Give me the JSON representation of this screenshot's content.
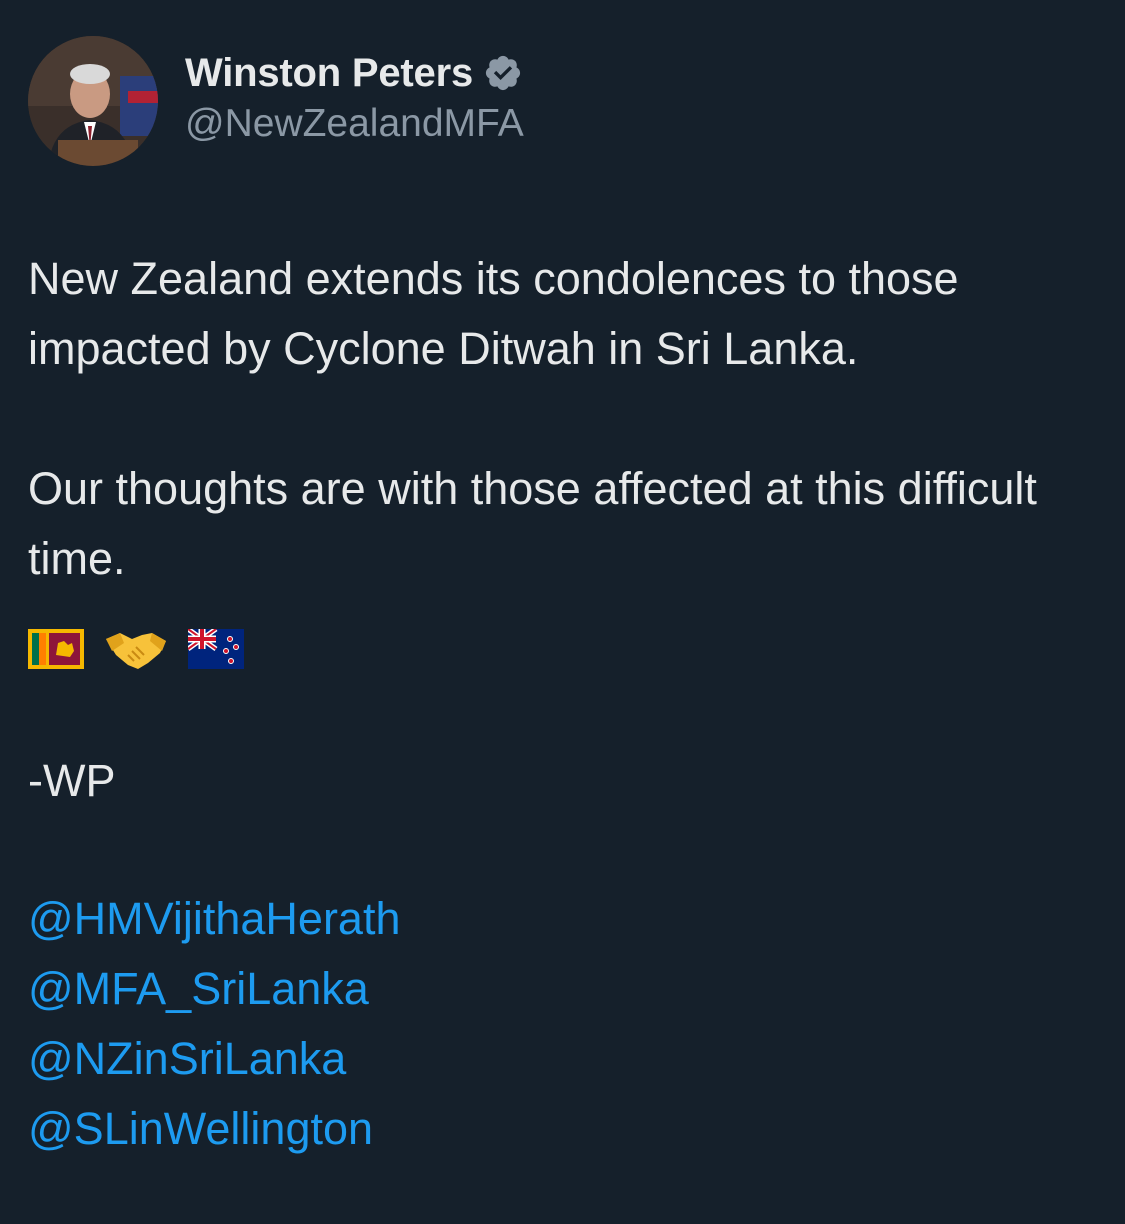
{
  "author": {
    "display_name": "Winston Peters",
    "handle": "@NewZealandMFA",
    "verified": true,
    "avatar_icon": "avatar-photo"
  },
  "tweet": {
    "paragraph_1": "New Zealand extends its condolences to those impacted by Cyclone Ditwah in Sri Lanka.",
    "paragraph_2": "Our thoughts are with those affected at this difficult time.",
    "emojis": [
      "sri-lanka-flag-icon",
      "handshake-icon",
      "new-zealand-flag-icon"
    ],
    "signoff": "-WP",
    "mentions": [
      "@HMVijithaHerath",
      "@MFA_SriLanka",
      "@NZinSriLanka",
      "@SLinWellington"
    ]
  },
  "colors": {
    "background": "#15202b",
    "text": "#e7e9ea",
    "secondary_text": "#8b98a5",
    "link": "#1d9bf0",
    "verified_badge": "#8b98a5"
  }
}
